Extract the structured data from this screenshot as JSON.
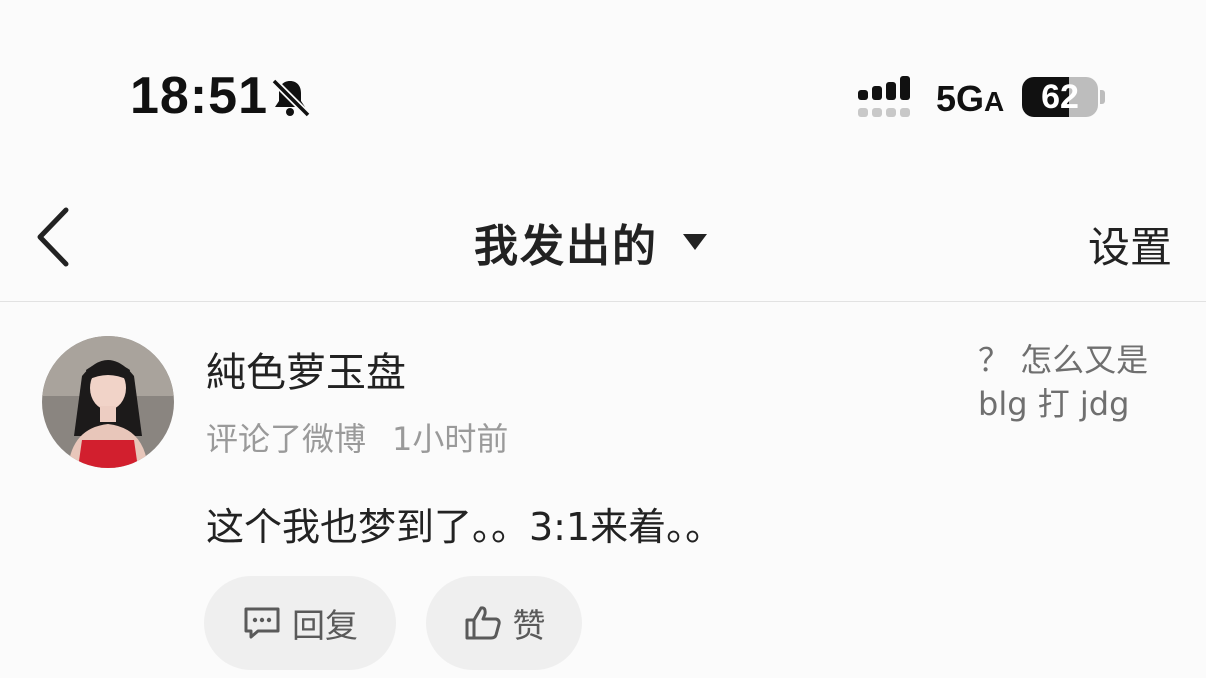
{
  "status_bar": {
    "time": "18:51",
    "network": "5G",
    "network_suffix": "A",
    "battery": "62",
    "icons": [
      "bell-muted-icon",
      "signal-icon",
      "battery-icon"
    ]
  },
  "nav": {
    "title": "我发出的",
    "settings_label": "设置",
    "icons": [
      "back-chevron-icon",
      "caret-down-icon"
    ]
  },
  "comment": {
    "username": "純色萝玉盘",
    "action": "评论了微博",
    "time_ago": "1小时前",
    "quote_line1": "？ 怎么又是",
    "quote_line2": "blg 打 jdg",
    "text": "这个我也梦到了。。3:1来着。。",
    "reply_label": "回复",
    "like_label": "赞",
    "icons": [
      "reply-icon",
      "thumbs-up-icon"
    ]
  },
  "colors": {
    "background": "#fbfbfb",
    "pill": "#efefef",
    "muted_text": "#9a9a9a"
  }
}
